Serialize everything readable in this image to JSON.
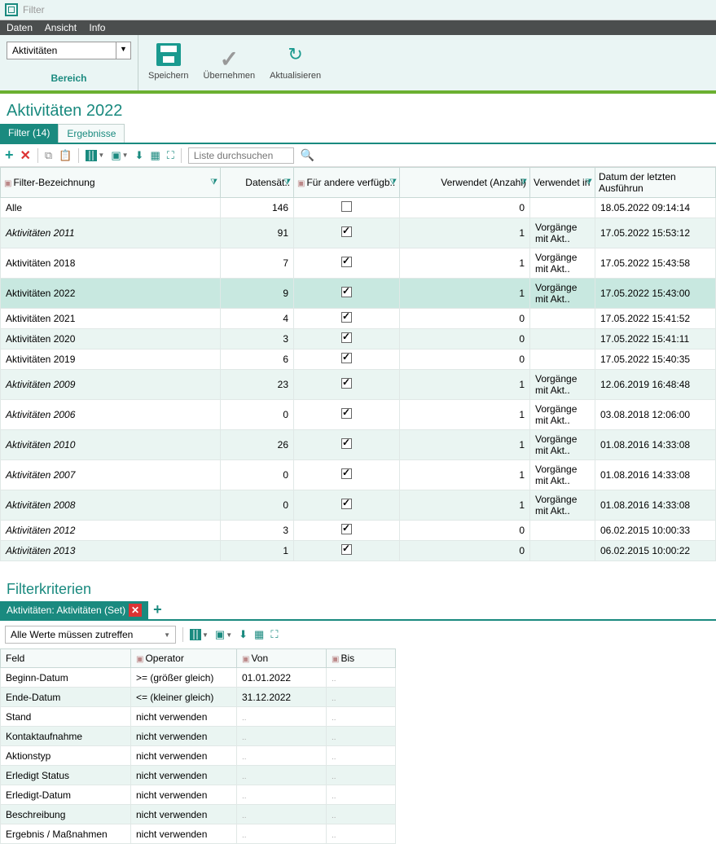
{
  "window": {
    "title": "Filter"
  },
  "menu": {
    "items": [
      "Daten",
      "Ansicht",
      "Info"
    ]
  },
  "ribbon": {
    "area_value": "Aktivitäten",
    "area_label": "Bereich",
    "actions": {
      "save": "Speichern",
      "apply": "Übernehmen",
      "refresh": "Aktualisieren"
    }
  },
  "page": {
    "title": "Aktivitäten 2022"
  },
  "tabs": {
    "filter": "Filter (14)",
    "results": "Ergebnisse"
  },
  "toolbar": {
    "search_placeholder": "Liste durchsuchen"
  },
  "columns": {
    "name": "Filter-Bezeichnung",
    "records": "Datensät..",
    "available": "Für andere verfügb..",
    "used_count": "Verwendet (Anzahl)",
    "used_in": "Verwendet in",
    "last_run": "Datum der letzten Ausführun"
  },
  "rows": [
    {
      "name": "Alle",
      "italic": false,
      "records": "146",
      "available": false,
      "used_count": "0",
      "used_in": "",
      "last_run": "18.05.2022 09:14:14",
      "selected": false
    },
    {
      "name": "Aktivitäten 2011",
      "italic": true,
      "records": "91",
      "available": true,
      "used_count": "1",
      "used_in": "Vorgänge mit Akt..",
      "last_run": "17.05.2022 15:53:12",
      "selected": false
    },
    {
      "name": "Aktivitäten 2018",
      "italic": false,
      "records": "7",
      "available": true,
      "used_count": "1",
      "used_in": "Vorgänge mit Akt..",
      "last_run": "17.05.2022 15:43:58",
      "selected": false
    },
    {
      "name": "Aktivitäten 2022",
      "italic": false,
      "records": "9",
      "available": true,
      "used_count": "1",
      "used_in": "Vorgänge mit Akt..",
      "last_run": "17.05.2022 15:43:00",
      "selected": true
    },
    {
      "name": "Aktivitäten 2021",
      "italic": false,
      "records": "4",
      "available": true,
      "used_count": "0",
      "used_in": "",
      "last_run": "17.05.2022 15:41:52",
      "selected": false
    },
    {
      "name": "Aktivitäten 2020",
      "italic": false,
      "records": "3",
      "available": true,
      "used_count": "0",
      "used_in": "",
      "last_run": "17.05.2022 15:41:11",
      "selected": false
    },
    {
      "name": "Aktivitäten 2019",
      "italic": false,
      "records": "6",
      "available": true,
      "used_count": "0",
      "used_in": "",
      "last_run": "17.05.2022 15:40:35",
      "selected": false
    },
    {
      "name": "Aktivitäten 2009",
      "italic": true,
      "records": "23",
      "available": true,
      "used_count": "1",
      "used_in": "Vorgänge mit Akt..",
      "last_run": "12.06.2019 16:48:48",
      "selected": false
    },
    {
      "name": "Aktivitäten 2006",
      "italic": true,
      "records": "0",
      "available": true,
      "used_count": "1",
      "used_in": "Vorgänge mit Akt..",
      "last_run": "03.08.2018 12:06:00",
      "selected": false
    },
    {
      "name": "Aktivitäten 2010",
      "italic": true,
      "records": "26",
      "available": true,
      "used_count": "1",
      "used_in": "Vorgänge mit Akt..",
      "last_run": "01.08.2016 14:33:08",
      "selected": false
    },
    {
      "name": "Aktivitäten 2007",
      "italic": true,
      "records": "0",
      "available": true,
      "used_count": "1",
      "used_in": "Vorgänge mit Akt..",
      "last_run": "01.08.2016 14:33:08",
      "selected": false
    },
    {
      "name": "Aktivitäten 2008",
      "italic": true,
      "records": "0",
      "available": true,
      "used_count": "1",
      "used_in": "Vorgänge mit Akt..",
      "last_run": "01.08.2016 14:33:08",
      "selected": false
    },
    {
      "name": "Aktivitäten 2012",
      "italic": true,
      "records": "3",
      "available": true,
      "used_count": "0",
      "used_in": "",
      "last_run": "06.02.2015 10:00:33",
      "selected": false
    },
    {
      "name": "Aktivitäten 2013",
      "italic": true,
      "records": "1",
      "available": true,
      "used_count": "0",
      "used_in": "",
      "last_run": "06.02.2015 10:00:22",
      "selected": false
    }
  ],
  "criteria": {
    "title": "Filterkriterien",
    "tab": "Aktivitäten: Aktivitäten (Set)",
    "mode": "Alle Werte müssen zutreffen",
    "columns": {
      "field": "Feld",
      "operator": "Operator",
      "from": "Von",
      "to": "Bis"
    },
    "rows": [
      {
        "field": "Beginn-Datum",
        "operator": ">= (größer gleich)",
        "from": "01.01.2022",
        "to": ".."
      },
      {
        "field": "Ende-Datum",
        "operator": "<= (kleiner gleich)",
        "from": "31.12.2022",
        "to": ".."
      },
      {
        "field": "Stand",
        "operator": "nicht verwenden",
        "from": "..",
        "to": ".."
      },
      {
        "field": "Kontaktaufnahme",
        "operator": "nicht verwenden",
        "from": "..",
        "to": ".."
      },
      {
        "field": "Aktionstyp",
        "operator": "nicht verwenden",
        "from": "..",
        "to": ".."
      },
      {
        "field": "Erledigt Status",
        "operator": "nicht verwenden",
        "from": "..",
        "to": ".."
      },
      {
        "field": "Erledigt-Datum",
        "operator": "nicht verwenden",
        "from": "..",
        "to": ".."
      },
      {
        "field": "Beschreibung",
        "operator": "nicht verwenden",
        "from": "..",
        "to": ".."
      },
      {
        "field": "Ergebnis / Maßnahmen",
        "operator": "nicht verwenden",
        "from": "..",
        "to": ".."
      }
    ]
  }
}
